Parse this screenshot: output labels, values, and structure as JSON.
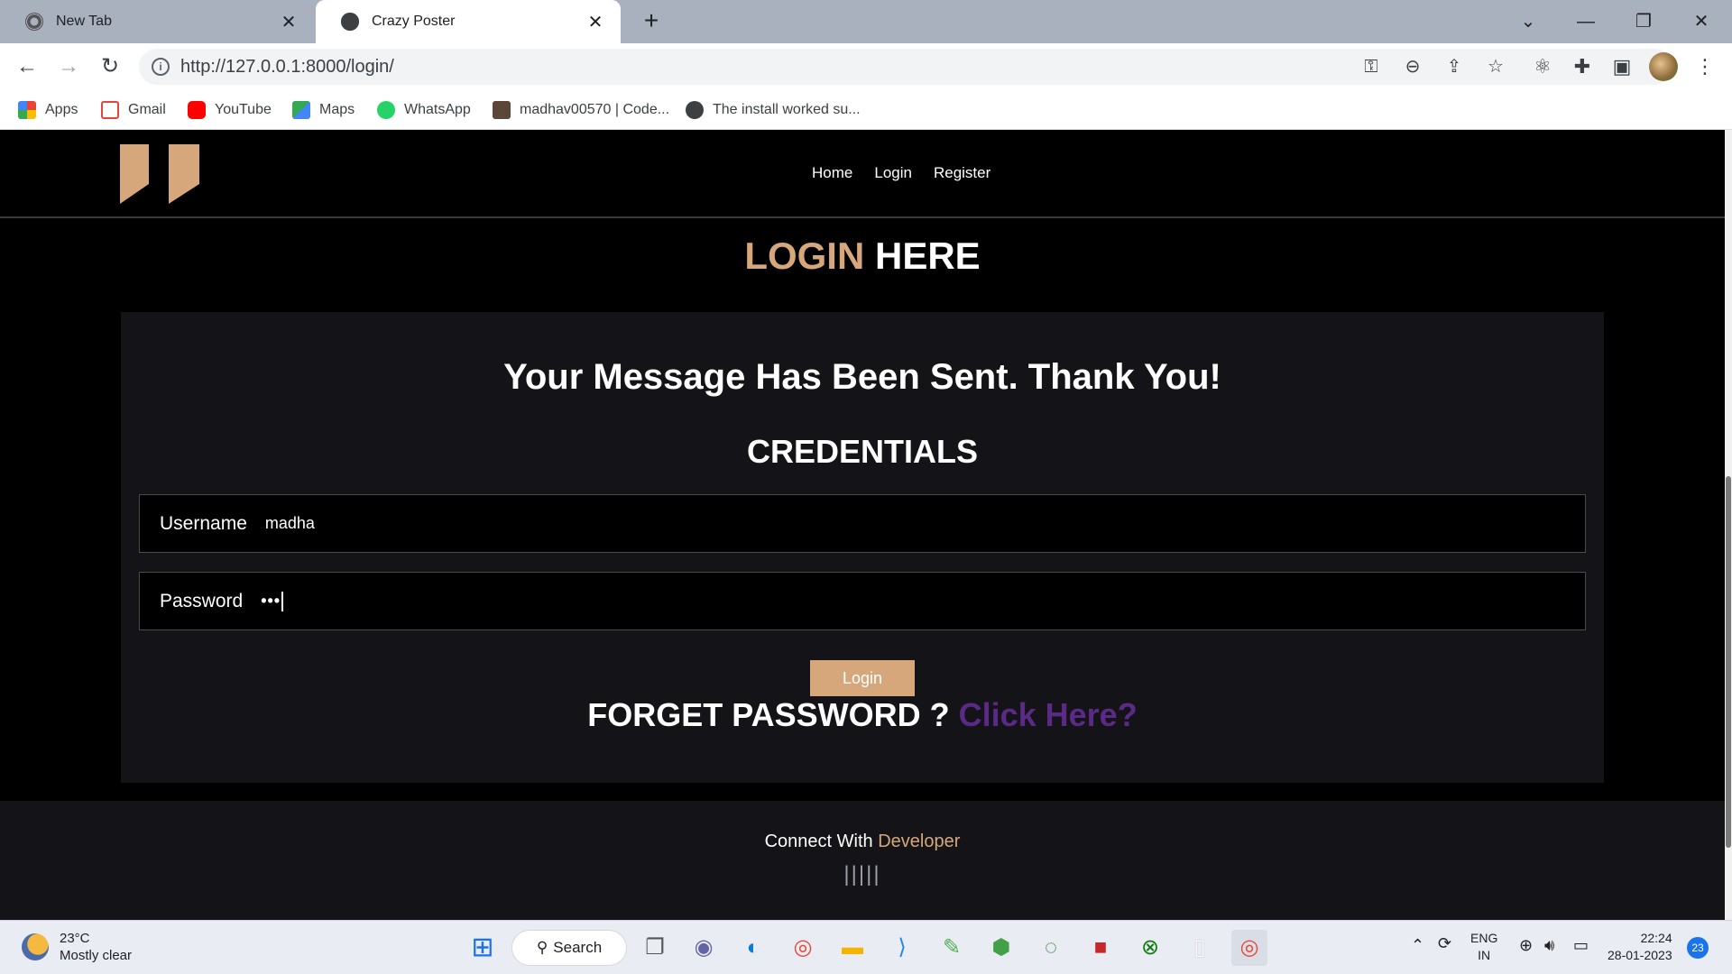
{
  "browser": {
    "tabs": [
      {
        "title": "New Tab",
        "close": "✕"
      },
      {
        "title": "Crazy Poster",
        "close": "✕"
      }
    ],
    "new_tab": "+",
    "window_controls": {
      "tab_search": "⌄",
      "minimize": "—",
      "restore": "❐",
      "close": "✕"
    },
    "url": "http://127.0.0.1:8000/login/",
    "bookmarks": [
      {
        "label": "Apps",
        "icon": "apps-grid-icon",
        "color": "#ea4335"
      },
      {
        "label": "Gmail",
        "icon": "gmail-icon",
        "color": "#ea4335"
      },
      {
        "label": "YouTube",
        "icon": "youtube-icon",
        "color": "#ff0000"
      },
      {
        "label": "Maps",
        "icon": "maps-icon",
        "color": "#34a853"
      },
      {
        "label": "WhatsApp",
        "icon": "whatsapp-icon",
        "color": "#25d366"
      },
      {
        "label": "madhav00570 | Code...",
        "icon": "codechef-icon",
        "color": "#5b4638"
      },
      {
        "label": "The install worked su...",
        "icon": "globe-icon",
        "color": "#3c4043"
      }
    ]
  },
  "site": {
    "nav": [
      "Home",
      "Login",
      "Register"
    ],
    "heading_accent": "LOGIN",
    "heading_rest": " HERE",
    "message": "Your Message Has Been Sent. Thank You!",
    "credentials_title": "CREDENTIALS",
    "username_label": "Username",
    "username_value": "madha",
    "password_label": "Password",
    "password_value": "•••",
    "login_button": "Login",
    "forget_text": "FORGET PASSWORD ? ",
    "forget_link": "Click Here?",
    "footer_text": "Connect With ",
    "footer_accent": "Developer",
    "footer_socials": "|||||",
    "colors": {
      "accent": "#d6a77a",
      "link": "#5b2a86",
      "background": "#000000",
      "card": "#131318"
    }
  },
  "taskbar": {
    "temperature": "23°C",
    "weather": "Mostly clear",
    "search_label": "Search",
    "language": "ENG",
    "region": "IN",
    "time": "22:24",
    "date": "28-01-2023",
    "notifications": "23"
  }
}
